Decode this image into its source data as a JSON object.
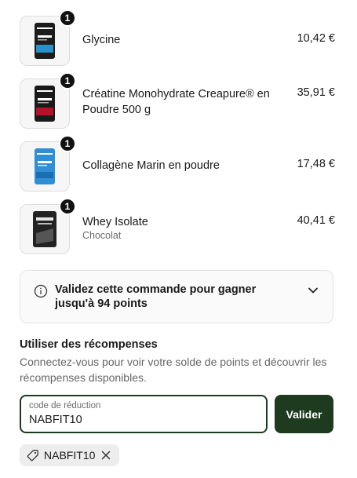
{
  "cart": {
    "items": [
      {
        "name": "Glycine",
        "variant": "",
        "price": "10,42 €",
        "quantity": "1",
        "pack_color": "#1c1c1c",
        "pack_accent": "#2aa6e8",
        "icon": "glycine-product-thumbnail"
      },
      {
        "name": "Créatine Monohydrate Creapure® en Poudre 500 g",
        "variant": "",
        "price": "35,91 €",
        "quantity": "1",
        "pack_color": "#1a1a1a",
        "pack_accent": "#c8102e",
        "icon": "creatine-product-thumbnail"
      },
      {
        "name": "Collagène Marin en poudre",
        "variant": "",
        "price": "17,48 €",
        "quantity": "1",
        "pack_color": "#2f8fd6",
        "pack_accent": "#ffffff",
        "icon": "collagen-product-thumbnail"
      },
      {
        "name": "Whey Isolate",
        "variant": "Chocolat",
        "price": "40,41 €",
        "quantity": "1",
        "pack_color": "#222222",
        "pack_accent": "#e6e6e6",
        "icon": "whey-product-thumbnail"
      }
    ]
  },
  "points": {
    "message": "Validez cette commande pour gagner jusqu'à 94 points"
  },
  "rewards": {
    "title": "Utiliser des récompenses",
    "description": "Connectez-vous pour voir votre solde de points et découvrir les récompenses disponibles."
  },
  "discount": {
    "label": "code de réduction",
    "value": "NABFIT10",
    "button": "Valider",
    "applied_code": "NABFIT10"
  },
  "colors": {
    "primary_button": "#1e3a1f",
    "badge": "#111111"
  }
}
